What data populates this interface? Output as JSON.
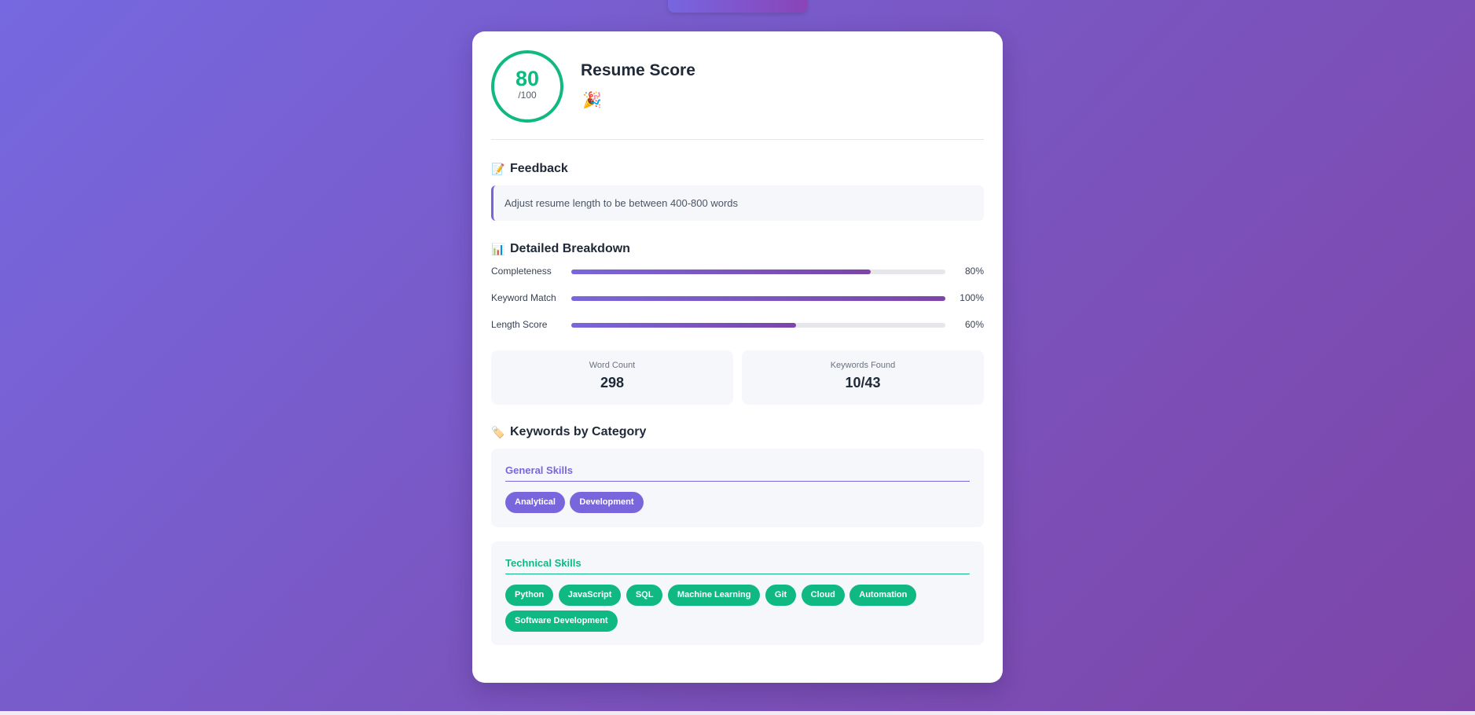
{
  "score": {
    "value": "80",
    "max": "/100",
    "title": "Resume Score",
    "emoji": "🎉",
    "color": "#10b981"
  },
  "feedback": {
    "icon": "📝",
    "title": "Feedback",
    "text": "Adjust resume length to be between 400-800 words"
  },
  "breakdown": {
    "icon": "📊",
    "title": "Detailed Breakdown",
    "items": [
      {
        "label": "Completeness",
        "value": "80%",
        "percent": 80
      },
      {
        "label": "Keyword Match",
        "value": "100%",
        "percent": 100
      },
      {
        "label": "Length Score",
        "value": "60%",
        "percent": 60
      }
    ]
  },
  "stats": [
    {
      "label": "Word Count",
      "value": "298"
    },
    {
      "label": "Keywords Found",
      "value": "10/43"
    }
  ],
  "keywords": {
    "icon": "🏷️",
    "title": "Keywords by Category",
    "categories": [
      {
        "name": "General Skills",
        "color": "#7a66dc",
        "tags": [
          "Analytical",
          "Development"
        ]
      },
      {
        "name": "Technical Skills",
        "color": "#10b981",
        "tags": [
          "Python",
          "JavaScript",
          "SQL",
          "Machine Learning",
          "Git",
          "Cloud",
          "Automation",
          "Software Development"
        ]
      }
    ]
  }
}
